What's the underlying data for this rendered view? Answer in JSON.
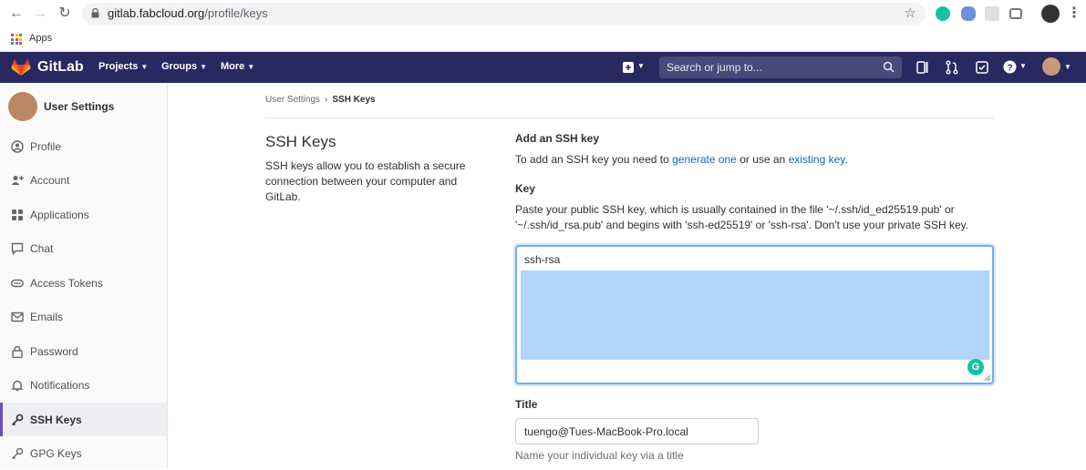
{
  "browser": {
    "url_host": "gitlab.fabcloud.org",
    "url_path": "/profile/keys",
    "bookmark_apps_label": "Apps"
  },
  "header": {
    "brand": "GitLab",
    "menus": [
      "Projects",
      "Groups",
      "More"
    ],
    "search_placeholder": "Search or jump to..."
  },
  "sidebar": {
    "title": "User Settings",
    "items": [
      {
        "label": "Profile",
        "icon": "profile-icon"
      },
      {
        "label": "Account",
        "icon": "account-icon"
      },
      {
        "label": "Applications",
        "icon": "applications-icon"
      },
      {
        "label": "Chat",
        "icon": "chat-icon"
      },
      {
        "label": "Access Tokens",
        "icon": "token-icon"
      },
      {
        "label": "Emails",
        "icon": "email-icon"
      },
      {
        "label": "Password",
        "icon": "lock-icon"
      },
      {
        "label": "Notifications",
        "icon": "bell-icon"
      },
      {
        "label": "SSH Keys",
        "icon": "key-icon",
        "active": true
      },
      {
        "label": "GPG Keys",
        "icon": "key-icon"
      }
    ]
  },
  "breadcrumb": {
    "parent": "User Settings",
    "current": "SSH Keys"
  },
  "left_panel": {
    "title": "SSH Keys",
    "description": "SSH keys allow you to establish a secure connection between your computer and GitLab."
  },
  "form": {
    "add_title": "Add an SSH key",
    "add_text_before": "To add an SSH key you need to ",
    "generate_link": "generate one",
    "add_text_middle": " or use an ",
    "existing_link": "existing key",
    "add_text_after": ".",
    "key_label": "Key",
    "key_help": "Paste your public SSH key, which is usually contained in the file '~/.ssh/id_ed25519.pub' or '~/.ssh/id_rsa.pub' and begins with 'ssh-ed25519' or 'ssh-rsa'. Don't use your private SSH key.",
    "key_value": "ssh-rsa",
    "title_label": "Title",
    "title_value": "tuengo@Tues-MacBook-Pro.local",
    "title_hint": "Name your individual key via a title"
  },
  "colors": {
    "header_bg": "#292961",
    "link": "#1068bf",
    "active_indicator": "#6b4fbb",
    "selection": "#b2d4f8"
  }
}
